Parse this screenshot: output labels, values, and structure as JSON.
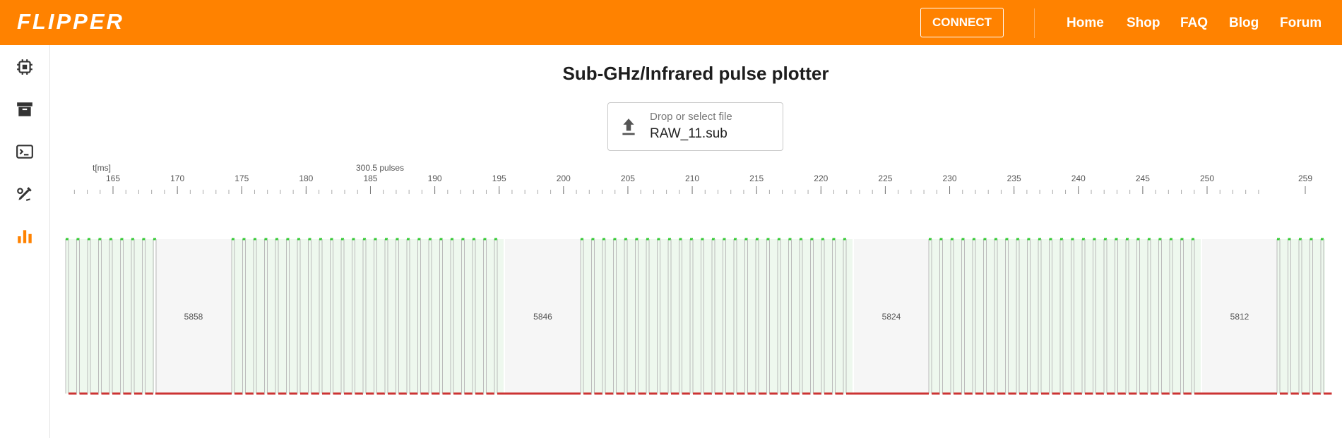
{
  "header": {
    "logo": "FLIPPER",
    "connect_label": "CONNECT",
    "nav": [
      "Home",
      "Shop",
      "FAQ",
      "Blog",
      "Forum"
    ]
  },
  "sidebar": {
    "items": [
      {
        "icon": "chip-icon",
        "active": false
      },
      {
        "icon": "archive-icon",
        "active": false
      },
      {
        "icon": "terminal-icon",
        "active": false
      },
      {
        "icon": "paint-icon",
        "active": false
      },
      {
        "icon": "bar-chart-icon",
        "active": true
      }
    ]
  },
  "main": {
    "title": "Sub-GHz/Infrared pulse plotter",
    "file_input": {
      "placeholder": "Drop or select file",
      "value": "RAW_11.sub"
    }
  },
  "plot": {
    "axis_label": "t[ms]",
    "pulses_label": "300.5 pulses",
    "ticks": [
      165,
      170,
      175,
      180,
      185,
      190,
      195,
      200,
      205,
      210,
      215,
      220,
      225,
      230,
      235,
      240,
      245,
      250,
      259
    ],
    "gap_labels": [
      "5858",
      "5846",
      "5824",
      "5812"
    ]
  },
  "colors": {
    "accent": "#ff8200",
    "high": "#33cc33",
    "low": "#cc3333",
    "active_icon": "#ff8200"
  }
}
